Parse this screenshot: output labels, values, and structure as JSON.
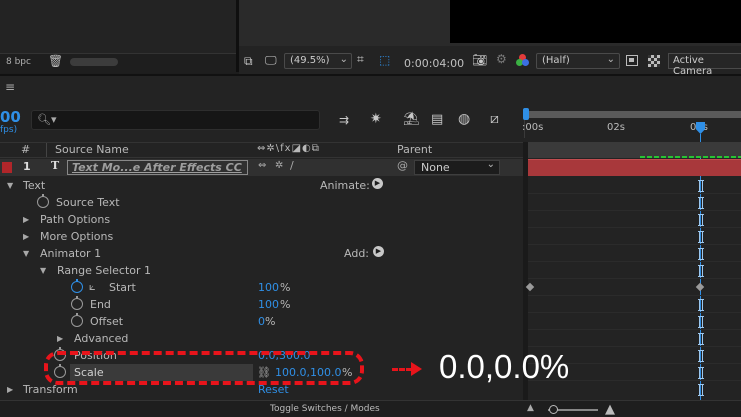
{
  "viewer": {
    "bpc": "8 bpc",
    "zoom": "(49.5%)",
    "timecode": "0:00:04:00",
    "resolution": "(Half)",
    "camera": "Active Camera"
  },
  "comp": {
    "time_fragment": "00",
    "fps_fragment": "fps)",
    "search_icon": "🔍︎▾"
  },
  "columns": {
    "hash": "#",
    "source_name": "Source Name",
    "switch_icons": "⇔✲\\fx◪◐⧉",
    "parent": "Parent"
  },
  "layer": {
    "number": "1",
    "type_icon": "T",
    "name": "Text Mo...e After Effects CC",
    "parent_value": "None"
  },
  "props": {
    "text": "Text",
    "animate": "Animate:",
    "source_text": "Source Text",
    "path_options": "Path Options",
    "more_options": "More Options",
    "animator": "Animator 1",
    "add": "Add:",
    "range_selector": "Range Selector 1",
    "start": "Start",
    "start_val": "100",
    "end": "End",
    "end_val": "100",
    "offset": "Offset",
    "offset_val": "0",
    "percent": "%",
    "advanced": "Advanced",
    "position": "Position",
    "position_val": "0.0,300.0",
    "scale": "Scale",
    "scale_val": "100.0,100.0",
    "transform": "Transform",
    "reset": "Reset"
  },
  "timeline": {
    "ticks": [
      ":00s",
      "02s",
      "04s"
    ]
  },
  "footer": {
    "toggle": "Toggle Switches / Modes"
  },
  "annotation": {
    "value": "0.0,0.0%",
    "color": "#e8141b"
  }
}
